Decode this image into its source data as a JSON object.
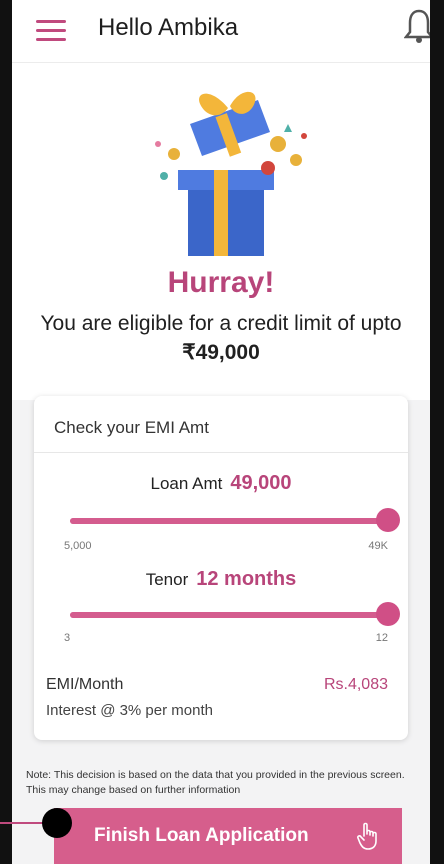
{
  "header": {
    "greeting": "Hello Ambika"
  },
  "hero": {
    "title": "Hurray!",
    "subtitle": "You are eligible for a credit limit of upto",
    "amount": "₹49,000"
  },
  "emi_card": {
    "title": "Check your EMI Amt",
    "loan": {
      "label": "Loan Amt",
      "value": "49,000",
      "min_label": "5,000",
      "max_label": "49K",
      "fraction": 1.0
    },
    "tenor": {
      "label": "Tenor",
      "value": "12 months",
      "min_label": "3",
      "max_label": "12",
      "fraction": 1.0
    },
    "emi_label": "EMI/Month",
    "emi_value": "Rs.4,083",
    "interest": "Interest @ 3% per month"
  },
  "note": "Note: This decision is based on the data that you provided in the previous screen. This may change based on further information",
  "cta": {
    "label": "Finish Loan Application"
  },
  "colors": {
    "accent": "#b8457a",
    "slider": "#d45c8e",
    "button": "#d65e8c"
  },
  "icons": [
    "menu-icon",
    "bell-icon",
    "gift-illustration",
    "hand-pointer-icon"
  ]
}
